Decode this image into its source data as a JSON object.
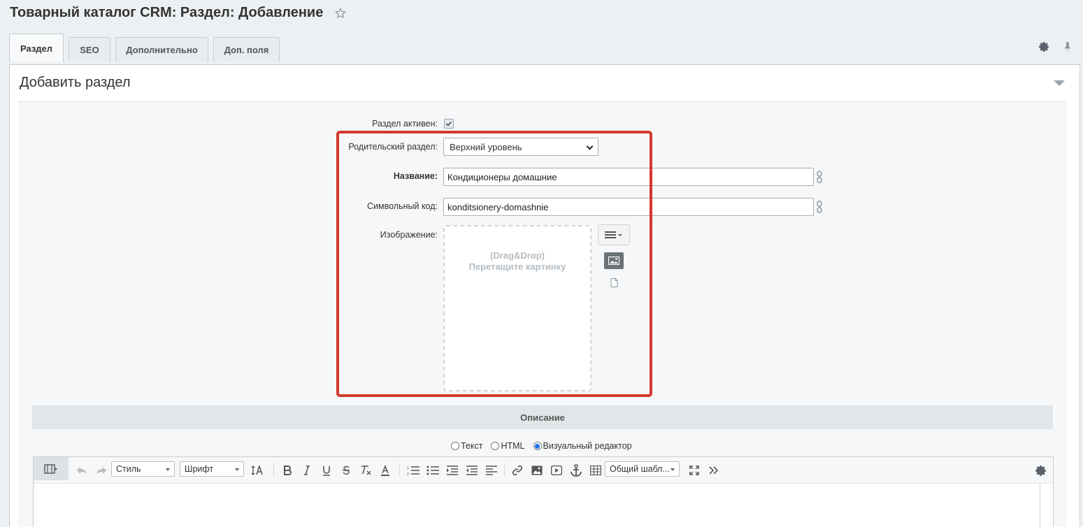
{
  "page": {
    "title": "Товарный каталог CRM: Раздел: Добавление"
  },
  "tabs": [
    {
      "label": "Раздел",
      "active": true
    },
    {
      "label": "SEO",
      "active": false
    },
    {
      "label": "Дополнительно",
      "active": false
    },
    {
      "label": "Доп. поля",
      "active": false
    }
  ],
  "panel": {
    "title": "Добавить раздел"
  },
  "form": {
    "active_label": "Раздел активен:",
    "active_checked": true,
    "parent_label": "Родительский раздел:",
    "parent_value": "Верхний уровень",
    "name_label": "Название:",
    "name_value": "Кондиционеры домашние",
    "code_label": "Символьный код:",
    "code_value": "konditsionery-domashnie",
    "image_label": "Изображение:",
    "dropzone_line1": "(Drag&Drop)",
    "dropzone_line2": "Перетащите картинку"
  },
  "description": {
    "section_title": "Описание",
    "mode_text": "Текст",
    "mode_html": "HTML",
    "mode_visual": "Визуальный редактор",
    "selected_mode": "visual"
  },
  "editor": {
    "style_select": "Стиль",
    "font_select": "Шрифт",
    "template_select": "Общий шабл..."
  },
  "colors": {
    "highlight": "#d33a2c",
    "radio_accent": "#1a73e8"
  }
}
